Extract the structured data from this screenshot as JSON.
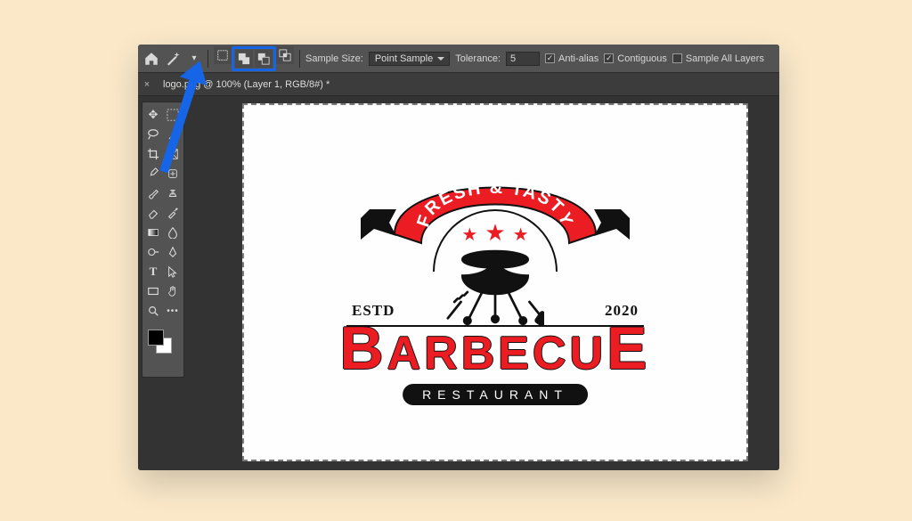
{
  "options_bar": {
    "sample_size_label": "Sample Size:",
    "sample_size_value": "Point Sample",
    "tolerance_label": "Tolerance:",
    "tolerance_value": "5",
    "anti_alias_label": "Anti-alias",
    "anti_alias_checked": true,
    "contiguous_label": "Contiguous",
    "contiguous_checked": true,
    "sample_all_label": "Sample All Layers",
    "sample_all_checked": false
  },
  "document_tab": {
    "title": "logo.png @ 100% (Layer 1, RGB/8#) *"
  },
  "canvas_logo": {
    "ribbon_text": "FRESH & TASTY",
    "estd_label": "ESTD",
    "year_label": "2020",
    "main_text": "BARBECUE",
    "sub_text": "RESTAURANT"
  },
  "colors": {
    "accent_red": "#eb1d23",
    "highlight_blue": "#1565e6"
  }
}
